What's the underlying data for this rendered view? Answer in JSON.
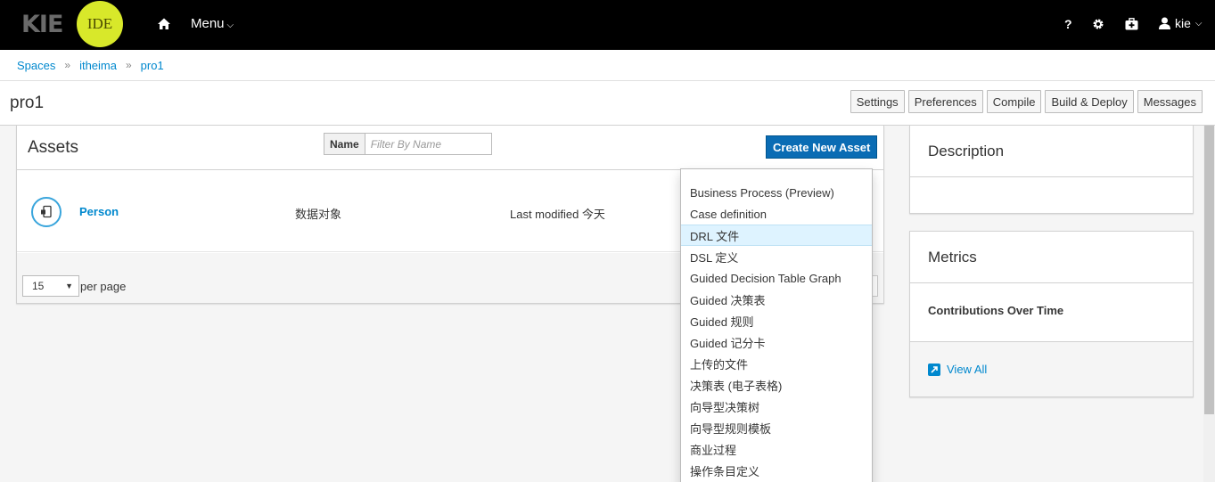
{
  "navbar": {
    "logo_text": "KIE",
    "logo_badge": "IDE",
    "menu_label": "Menu",
    "help_label": "?",
    "user_label": "kie"
  },
  "breadcrumb": {
    "items": [
      "Spaces",
      "itheima",
      "pro1"
    ],
    "separator": "»"
  },
  "title_bar": {
    "title": "pro1",
    "buttons": [
      "Settings",
      "Preferences",
      "Compile",
      "Build & Deploy",
      "Messages"
    ]
  },
  "assets": {
    "title": "Assets",
    "filter_label": "Name",
    "filter_placeholder": "Filter By Name",
    "create_button": "Create New Asset",
    "rows": [
      {
        "name": "Person",
        "type": "数据对象",
        "modified": "Last modified 今天"
      }
    ],
    "page_size": "15",
    "per_page_label": "per page"
  },
  "create_menu": {
    "items": [
      "Business Process (Preview)",
      "Case definition",
      "DRL 文件",
      "DSL 定义",
      "Guided Decision Table Graph",
      "Guided 决策表",
      "Guided 规则",
      "Guided 记分卡",
      "上传的文件",
      "决策表 (电子表格)",
      "向导型决策树",
      "向导型规则模板",
      "商业过程",
      "操作条目定义"
    ],
    "highlighted": "DRL 文件"
  },
  "description_card": {
    "title": "Description"
  },
  "metrics_card": {
    "title": "Metrics",
    "subtitle": "Contributions Over Time",
    "link": "View All"
  },
  "colors": {
    "accent": "#0088ce",
    "primary_button": "#0a6cb4",
    "logo_badge": "#d8e82a",
    "highlight": "#def3ff"
  }
}
